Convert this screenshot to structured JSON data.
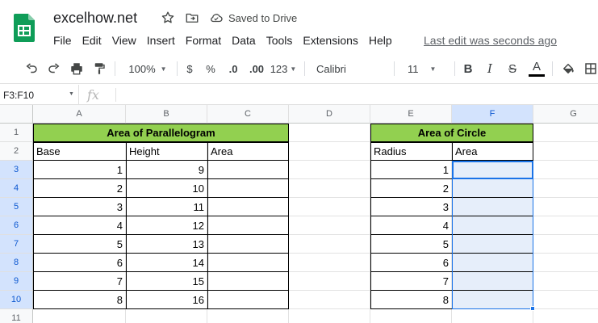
{
  "document": {
    "title": "excelhow.net",
    "save_status": "Saved to Drive",
    "last_edit": "Last edit was seconds ago"
  },
  "menu": [
    "File",
    "Edit",
    "View",
    "Insert",
    "Format",
    "Data",
    "Tools",
    "Extensions",
    "Help"
  ],
  "toolbar": {
    "zoom": "100%",
    "currency": "$",
    "percent": "%",
    "decrease_decimal": ".0",
    "increase_decimal": ".00",
    "more_formats": "123",
    "font": "Calibri",
    "font_size": "11",
    "bold": "B",
    "italic": "I",
    "strikethrough": "S",
    "text_color": "A",
    "text_color_value": "#000000"
  },
  "formula_bar": {
    "name_box": "F3:F10",
    "fx": "fx",
    "value": ""
  },
  "colors": {
    "header_green": "#92d050",
    "selection_blue": "#1a73e8"
  },
  "columns": [
    "A",
    "B",
    "C",
    "D",
    "E",
    "F",
    "G"
  ],
  "rows": [
    "1",
    "2",
    "3",
    "4",
    "5",
    "6",
    "7",
    "8",
    "9",
    "10",
    "11"
  ],
  "selected_column": "F",
  "selected_range": "F3:F10",
  "tables": {
    "parallelogram": {
      "title": "Area of Parallelogram",
      "headers": [
        "Base",
        "Height",
        "Area"
      ],
      "rows": [
        [
          1,
          9,
          ""
        ],
        [
          2,
          10,
          ""
        ],
        [
          3,
          11,
          ""
        ],
        [
          4,
          12,
          ""
        ],
        [
          5,
          13,
          ""
        ],
        [
          6,
          14,
          ""
        ],
        [
          7,
          15,
          ""
        ],
        [
          8,
          16,
          ""
        ]
      ]
    },
    "circle": {
      "title": "Area of Circle",
      "headers": [
        "Radius",
        "Area"
      ],
      "rows": [
        [
          1,
          ""
        ],
        [
          2,
          ""
        ],
        [
          3,
          ""
        ],
        [
          4,
          ""
        ],
        [
          5,
          ""
        ],
        [
          6,
          ""
        ],
        [
          7,
          ""
        ],
        [
          8,
          ""
        ]
      ]
    }
  }
}
